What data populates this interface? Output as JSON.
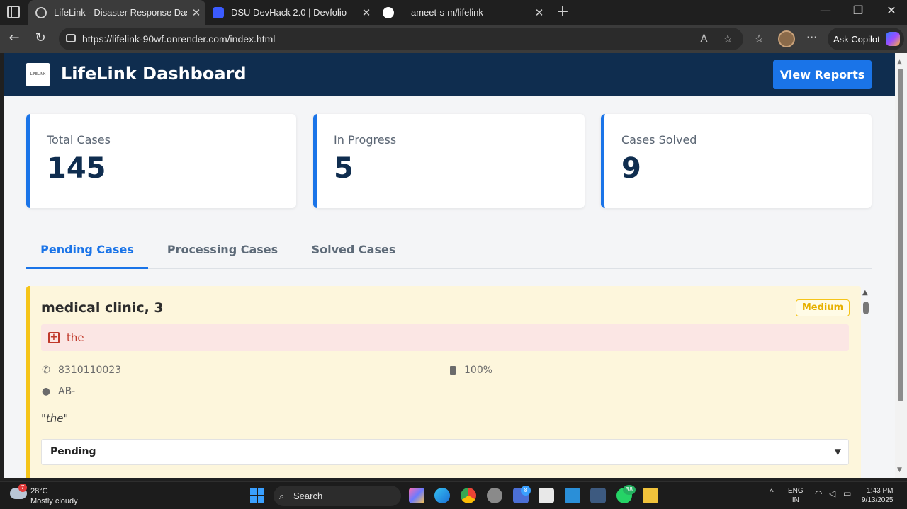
{
  "browser": {
    "tabs": [
      {
        "title": "LifeLink - Disaster Response Dash",
        "active": true
      },
      {
        "title": "DSU DevHack 2.0 | Devfolio",
        "active": false
      },
      {
        "title": "ameet-s-m/lifelink",
        "active": false
      }
    ],
    "url": "https://lifelink-90wf.onrender.com/index.html",
    "copilot_label": "Ask Copilot"
  },
  "header": {
    "logo_text": "LIFELINK",
    "title": "LifeLink Dashboard",
    "view_reports_label": "View Reports"
  },
  "stats": [
    {
      "label": "Total Cases",
      "value": "145"
    },
    {
      "label": "In Progress",
      "value": "5"
    },
    {
      "label": "Cases Solved",
      "value": "9"
    }
  ],
  "case_tabs": [
    {
      "label": "Pending Cases",
      "active": true
    },
    {
      "label": "Processing Cases",
      "active": false
    },
    {
      "label": "Solved Cases",
      "active": false
    }
  ],
  "case": {
    "title": "medical clinic, 3",
    "priority": "Medium",
    "need": "the",
    "phone": "8310110023",
    "battery": "100%",
    "blood_group": "AB-",
    "message": "\"the\"",
    "status": "Pending"
  },
  "taskbar": {
    "weather_temp": "28°C",
    "weather_desc": "Mostly cloudy",
    "weather_alert": "7",
    "search_label": "Search",
    "teams_badge": "8",
    "whatsapp_badge": "38",
    "lang_1": "ENG",
    "lang_2": "IN",
    "time": "1:43 PM",
    "date": "9/13/2025"
  },
  "colors": {
    "header_bg": "#0f2d4f",
    "accent": "#1a74e8",
    "pending_border": "#f5c419",
    "case_bg": "#fdf6dc",
    "need_bg": "#fbe6e4",
    "need_text": "#c0392b"
  }
}
